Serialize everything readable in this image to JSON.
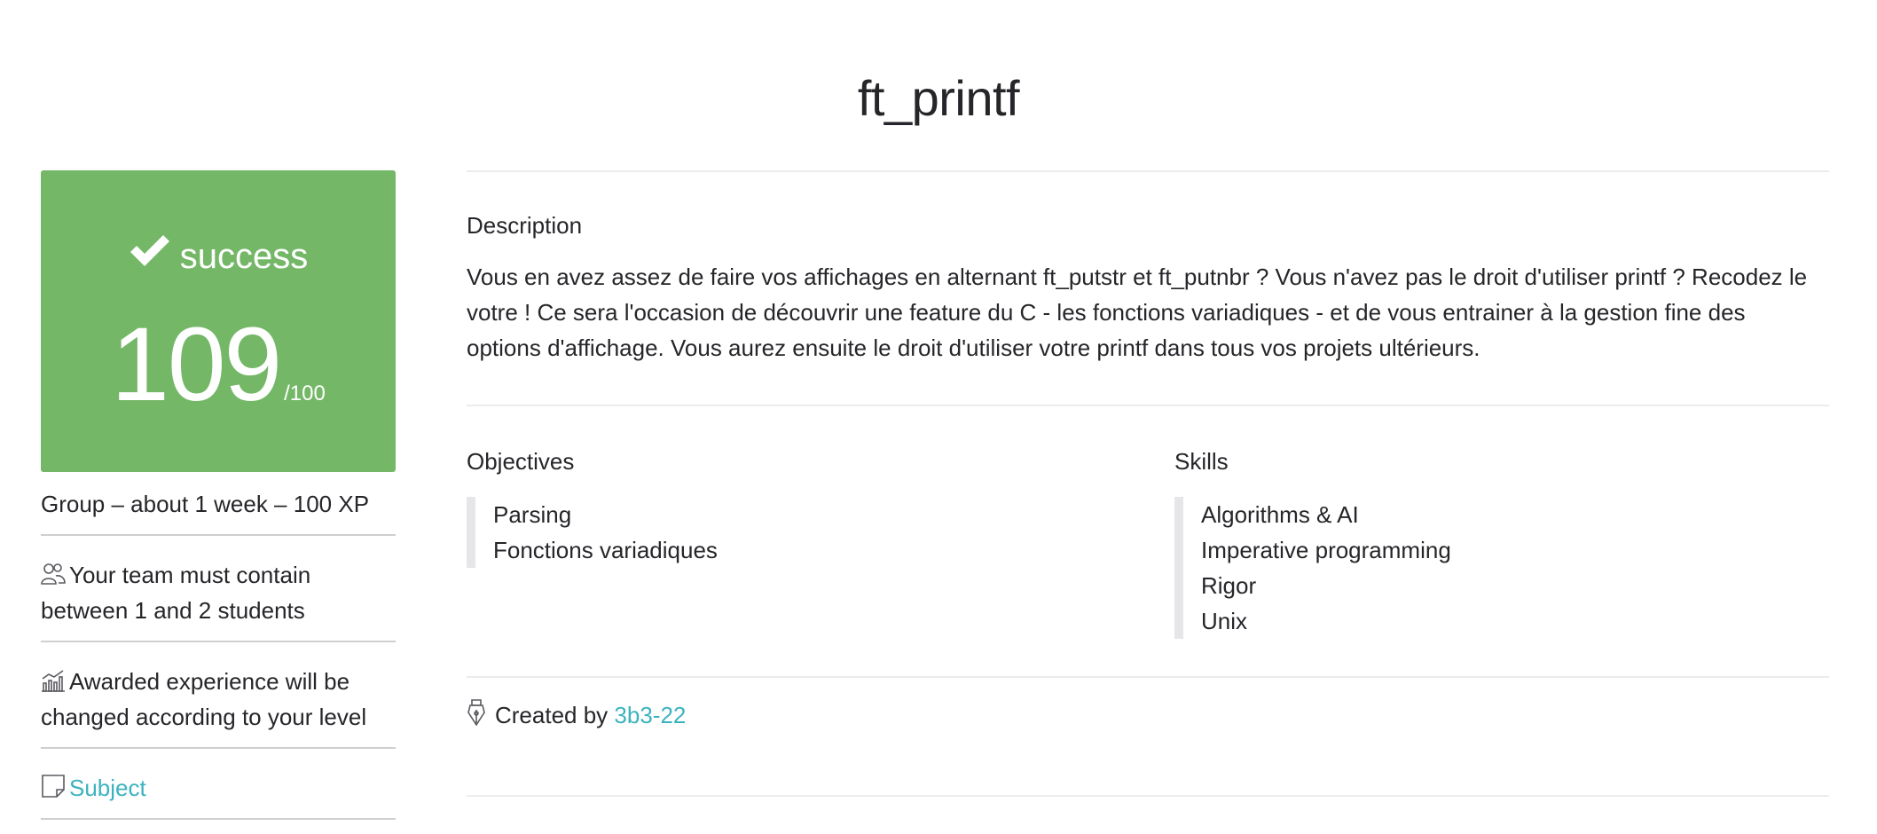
{
  "project": {
    "title": "ft_printf"
  },
  "result": {
    "status": "success",
    "score": "109",
    "max_score": "/100",
    "accent_color": "#74b767"
  },
  "meta": {
    "summary": "Group – about 1 week – 100 XP",
    "team_text": "Your team must contain between 1 and 2 students",
    "experience_text": "Awarded experience will be changed according to your level",
    "subject_link": "Subject",
    "icons": [
      "users-icon",
      "chart-icon",
      "note-icon"
    ]
  },
  "description": {
    "heading": "Description",
    "text": "Vous en avez assez de faire vos affichages en alternant ft_putstr et ft_putnbr ? Vous n'avez pas le droit d'utiliser printf ? Recodez le votre ! Ce sera l'occasion de découvrir une feature du C - les fonctions variadiques - et de vous entrainer à la gestion fine des options d'affichage. Vous aurez ensuite le droit d'utiliser votre printf dans tous vos projets ultérieurs."
  },
  "objectives": {
    "heading": "Objectives",
    "items": [
      "Parsing",
      "Fonctions variadiques"
    ]
  },
  "skills": {
    "heading": "Skills",
    "items": [
      "Algorithms & AI",
      "Imperative programming",
      "Rigor",
      "Unix"
    ]
  },
  "creator": {
    "prefix": "Created by",
    "name": "3b3-22",
    "link_color": "#3bb3bf"
  }
}
